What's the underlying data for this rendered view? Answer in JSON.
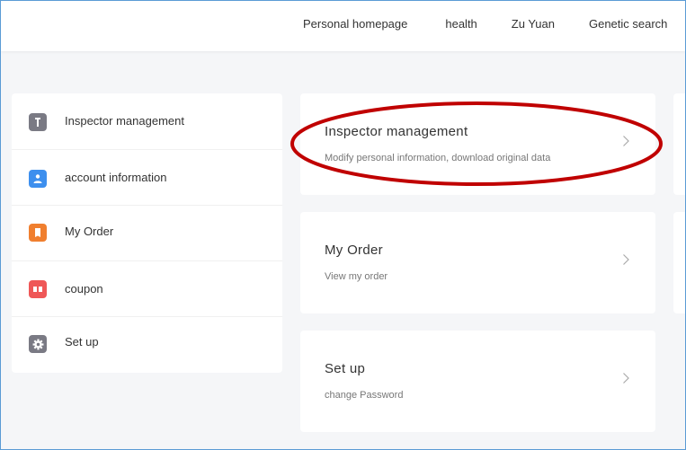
{
  "nav": {
    "items": [
      "Personal homepage",
      "health",
      "Zu Yuan",
      "Genetic search"
    ]
  },
  "sidebar": {
    "items": [
      {
        "label": "Inspector management",
        "icon": "tool-icon",
        "color": "#7a7a84"
      },
      {
        "label": "account information",
        "icon": "user-icon",
        "color": "#3d8fee"
      },
      {
        "label": "My Order",
        "icon": "order-icon",
        "color": "#f07f2f"
      },
      {
        "label": "coupon",
        "icon": "coupon-icon",
        "color": "#ef5757"
      },
      {
        "label": "Set up",
        "icon": "gear-icon",
        "color": "#7a7a84"
      }
    ]
  },
  "cards": [
    {
      "title": "Inspector management",
      "subtitle": "Modify personal information, download original data"
    },
    {
      "title": "My Order",
      "subtitle": "View my order"
    },
    {
      "title": "Set up",
      "subtitle": "change Password"
    }
  ],
  "colors": {
    "highlight": "#c00000",
    "frame_border": "#5b9bd5",
    "background": "#f5f6f8"
  }
}
